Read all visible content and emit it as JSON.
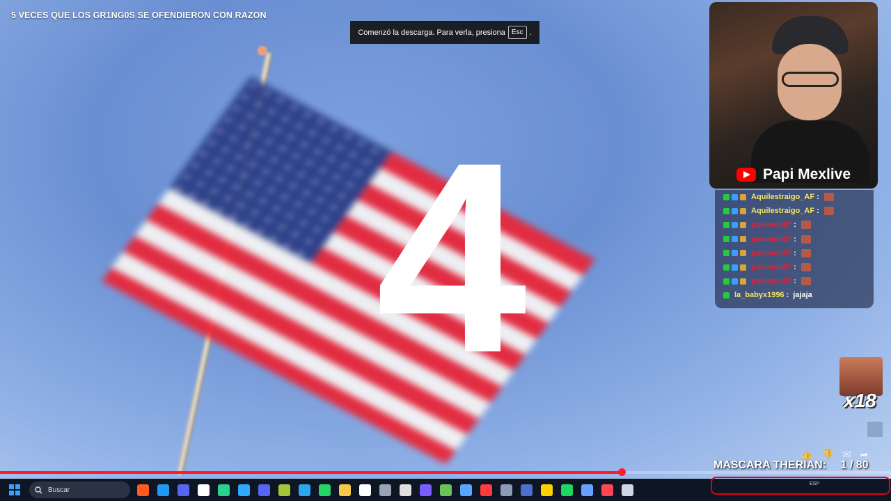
{
  "video": {
    "title": "5 VECES QUE LOS GR1NG0S SE OFENDIERON CON RAZON",
    "big_number": "4",
    "progress_fraction": 0.698,
    "download_toast": {
      "text": "Comenzó la descarga. Para verla, presiona",
      "key": "Esc",
      "suffix": "."
    }
  },
  "stream": {
    "channel_name": "Papi Mexlive",
    "chat": [
      {
        "user": "Aquilestraigo_AF",
        "color": "#f3e36a",
        "message": "",
        "has_emote": true
      },
      {
        "user": "Aquilestraigo_AF",
        "color": "#f3e36a",
        "message": "",
        "has_emote": true
      },
      {
        "user": "pakundo97",
        "color": "#e0233a",
        "message": "",
        "has_emote": true
      },
      {
        "user": "pakundo97",
        "color": "#e0233a",
        "message": "",
        "has_emote": true
      },
      {
        "user": "pakundo97",
        "color": "#e0233a",
        "message": "",
        "has_emote": true
      },
      {
        "user": "pakundo97",
        "color": "#e0233a",
        "message": "",
        "has_emote": true
      },
      {
        "user": "pakundo97",
        "color": "#e0233a",
        "message": "",
        "has_emote": true
      },
      {
        "user": "la_babyx1996",
        "color": "#f3e36a",
        "message": "jajaja",
        "has_emote": false
      }
    ],
    "reaction_count": "x18",
    "counter_label": "MASCARA THERIAN:",
    "counter_value": "1 / 80"
  },
  "player_actions": [
    "like-icon",
    "dislike-icon",
    "comment-icon",
    "share-icon"
  ],
  "taskbar": {
    "search_placeholder": "Buscar",
    "apps": [
      "brave-icon",
      "edge-icon",
      "vivaldi-icon",
      "capcut-icon",
      "app-icon",
      "photoshop-icon",
      "discord-icon",
      "android-icon",
      "telegram-icon",
      "whatsapp-icon",
      "folder-icon",
      "epic-icon",
      "audio-icon",
      "settings-icon",
      "davinci-icon",
      "camtasia-icon",
      "lens-icon",
      "record-icon",
      "image-icon",
      "game-icon",
      "notes-icon",
      "store-icon",
      "vpn-icon",
      "valorant-icon",
      "steam-icon"
    ],
    "tray_lang": "ESP"
  },
  "colors": {
    "progress": "#ff1a2e",
    "taskbar": "#0e1523",
    "tray_highlight": "#e0001b"
  }
}
